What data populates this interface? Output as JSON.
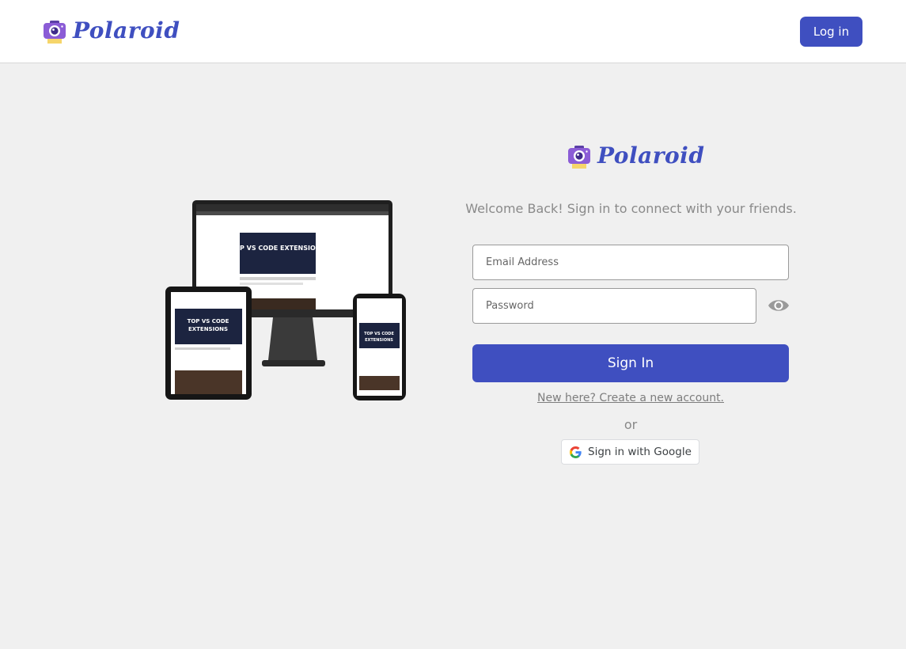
{
  "header": {
    "brand_name": "Polaroid",
    "login_label": "Log in"
  },
  "hero": {
    "screen_headline": "TOP VS CODE EXTENSIONS",
    "brand_name": "Polaroid"
  },
  "form": {
    "brand_name": "Polaroid",
    "welcome_text": "Welcome Back! Sign in to connect with your friends.",
    "email_placeholder": "Email Address",
    "password_placeholder": "Password",
    "signin_label": "Sign In",
    "create_account_link": "New here? Create a new account.",
    "or_text": "or",
    "google_label": "Sign in with Google"
  },
  "colors": {
    "accent": "#3f4fc0",
    "background": "#f0f0f0"
  },
  "icons": {
    "logo": "camera-icon",
    "password_toggle": "eye-icon",
    "google": "google-g-icon"
  }
}
